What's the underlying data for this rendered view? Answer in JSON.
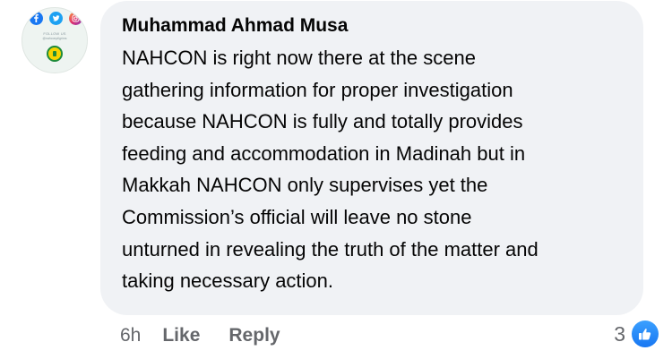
{
  "comment": {
    "author": "Muhammad Ahmad Musa",
    "lines": [
      "NAHCON is right now there at the scene",
      "gathering information for proper investigation",
      "because NAHCON is fully and totally provides",
      "feeding and accommodation in Madinah but in",
      "Makkah NAHCON only supervises yet the",
      "Commission’s official will leave no stone",
      "unturned in revealing the truth of the matter and",
      "taking necessary action."
    ],
    "timestamp": "6h",
    "like_label": "Like",
    "reply_label": "Reply",
    "reaction_count": "3",
    "reaction_icon": "thumbs-up-icon"
  },
  "avatar": {
    "follow_text": "FOLLOW US",
    "handle_text": "@nahconpilgrims",
    "icons": [
      "facebook-icon",
      "twitter-icon",
      "instagram-icon"
    ]
  },
  "colors": {
    "bubble_bg": "#f0f2f5",
    "text": "#050505",
    "secondary_text": "#65676b",
    "like_blue": "#1877f2"
  }
}
